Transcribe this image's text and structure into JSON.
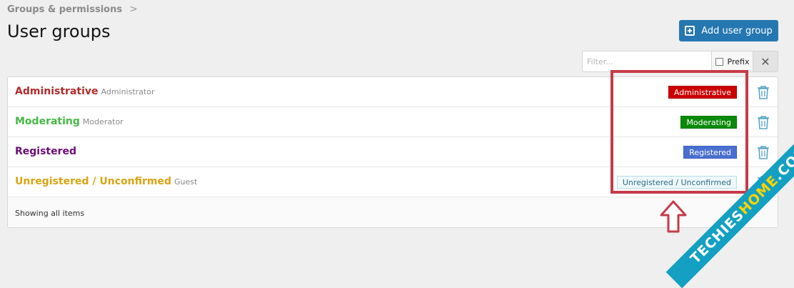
{
  "breadcrumb": {
    "label": "Groups & permissions",
    "separator": ">"
  },
  "page_title": "User groups",
  "add_button": {
    "label": "Add user group",
    "icon": "plus-square-icon"
  },
  "filter": {
    "placeholder": "Filter...",
    "value": "",
    "prefix_label": "Prefix",
    "prefix_checked": false,
    "clear_icon": "close-icon"
  },
  "groups": [
    {
      "name": "Administrative",
      "sub": "Administrator",
      "badge": "Administrative",
      "name_color": "#b12a2a",
      "badge_bg": "#cc0000",
      "badge_fg": "#ffffff",
      "badge_border": "#b30000"
    },
    {
      "name": "Moderating",
      "sub": "Moderator",
      "badge": "Moderating",
      "name_color": "#44b944",
      "badge_bg": "#0a8a0a",
      "badge_fg": "#ffffff",
      "badge_border": "#087a08"
    },
    {
      "name": "Registered",
      "sub": "",
      "badge": "Registered",
      "name_color": "#6c0d75",
      "badge_bg": "#4a6fcf",
      "badge_fg": "#ffffff",
      "badge_border": "#3a5fbf"
    },
    {
      "name": "Unregistered / Unconfirmed",
      "sub": "Guest",
      "badge": "Unregistered / Unconfirmed",
      "name_color": "#d9a312",
      "badge_bg": "#eef8fb",
      "badge_fg": "#2d6d84",
      "badge_border": "#b9dbe6"
    }
  ],
  "footer": {
    "text": "Showing all items"
  },
  "annotation": {
    "highlight_color": "#c63b49"
  },
  "watermark": {
    "text_main": "TECHIES",
    "text_accent": "HOME",
    "text_suffix": ".COM"
  }
}
